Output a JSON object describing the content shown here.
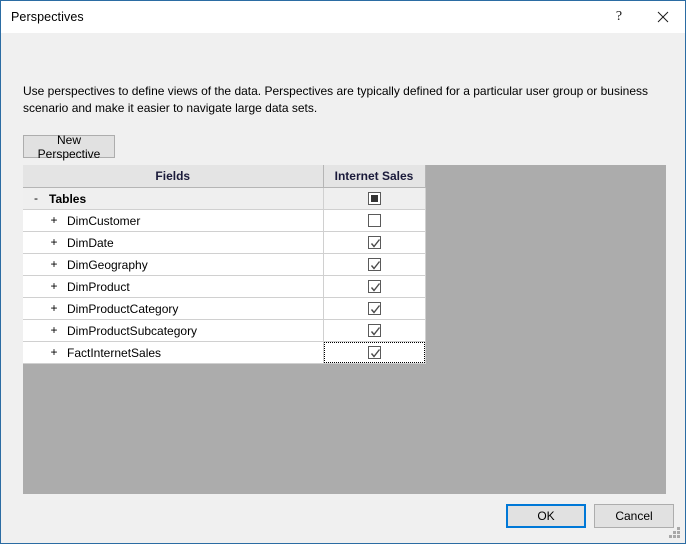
{
  "window": {
    "title": "Perspectives",
    "help_icon": "question-mark-icon",
    "close_icon": "close-icon"
  },
  "description": "Use perspectives to define views of the data. Perspectives are typically defined for a particular user group or business scenario and make it easier to navigate large data sets.",
  "toolbar": {
    "new_perspective_label": "New Perspective"
  },
  "grid": {
    "columns": [
      {
        "label": "Fields"
      },
      {
        "label": "Internet Sales"
      }
    ],
    "rows": [
      {
        "expander": "-",
        "label": "Tables",
        "indent": 0,
        "bold": true,
        "state": "indeterminate",
        "focused": false
      },
      {
        "expander": "+",
        "label": "DimCustomer",
        "indent": 1,
        "bold": false,
        "state": "unchecked",
        "focused": false
      },
      {
        "expander": "+",
        "label": "DimDate",
        "indent": 1,
        "bold": false,
        "state": "checked",
        "focused": false
      },
      {
        "expander": "+",
        "label": "DimGeography",
        "indent": 1,
        "bold": false,
        "state": "checked",
        "focused": false
      },
      {
        "expander": "+",
        "label": "DimProduct",
        "indent": 1,
        "bold": false,
        "state": "checked",
        "focused": false
      },
      {
        "expander": "+",
        "label": "DimProductCategory",
        "indent": 1,
        "bold": false,
        "state": "checked",
        "focused": false
      },
      {
        "expander": "+",
        "label": "DimProductSubcategory",
        "indent": 1,
        "bold": false,
        "state": "checked",
        "focused": false
      },
      {
        "expander": "+",
        "label": "FactInternetSales",
        "indent": 1,
        "bold": false,
        "state": "checked",
        "focused": true
      }
    ]
  },
  "footer": {
    "ok_label": "OK",
    "cancel_label": "Cancel",
    "gripper_icon": "resize-gripper-icon"
  },
  "colors": {
    "window_border": "#2b6ca3",
    "accent_focus": "#0078d7",
    "panel_gray": "#acacac",
    "dialog_bg": "#f0f0f0",
    "header_gray": "#e4e4e4"
  }
}
